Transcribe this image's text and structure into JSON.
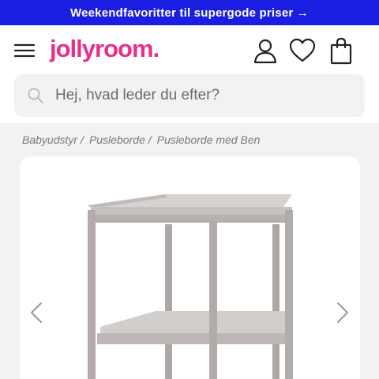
{
  "promo_banner": {
    "text": "Weekendfavoritter til supergode priser →"
  },
  "header": {
    "logo": "jollyroom."
  },
  "search": {
    "placeholder": "Hej, hvad leder du efter?"
  },
  "breadcrumb": {
    "items": [
      "Babyudstyr",
      "Pusleborde",
      "Pusleborde med Ben"
    ],
    "separator": "/"
  },
  "colors": {
    "brand_pink": "#e72f8a",
    "banner_blue": "#1a1ee0"
  }
}
